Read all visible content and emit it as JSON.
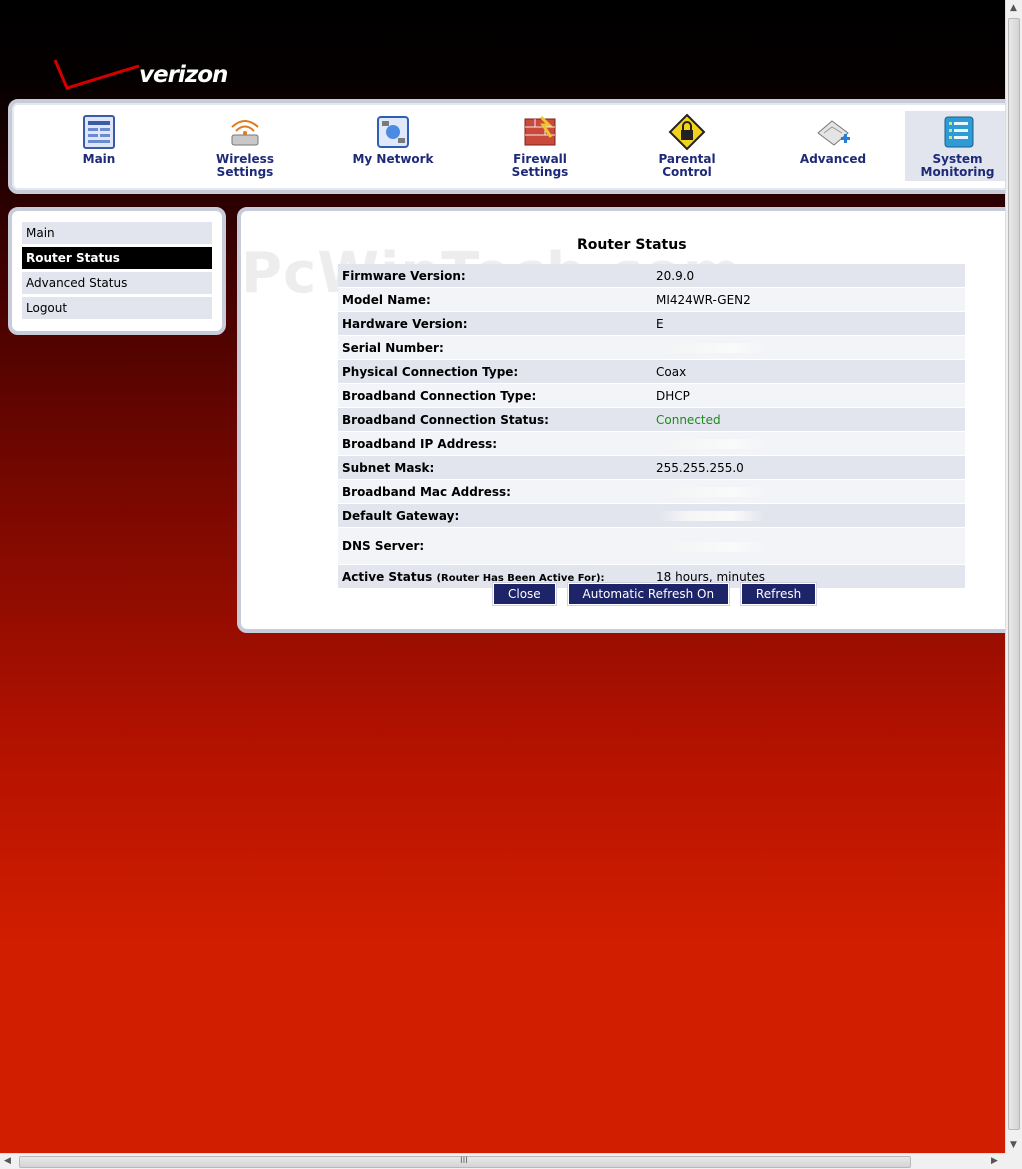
{
  "brand": {
    "logo_text": "verizon",
    "watermark": "PcWinTech.com"
  },
  "nav": [
    {
      "label": "Main",
      "icon": "main-icon",
      "active": false
    },
    {
      "label": "Wireless\nSettings",
      "icon": "wireless-icon",
      "active": false
    },
    {
      "label": "My Network",
      "icon": "network-icon",
      "active": false
    },
    {
      "label": "Firewall\nSettings",
      "icon": "firewall-icon",
      "active": false
    },
    {
      "label": "Parental\nControl",
      "icon": "lock-icon",
      "active": false
    },
    {
      "label": "Advanced",
      "icon": "advanced-icon",
      "active": false
    },
    {
      "label": "System\nMonitoring",
      "icon": "monitor-icon",
      "active": true
    }
  ],
  "sidebar": {
    "items": [
      {
        "label": "Main",
        "active": false
      },
      {
        "label": "Router Status",
        "active": true
      },
      {
        "label": "Advanced Status",
        "active": false
      },
      {
        "label": "Logout",
        "active": false
      }
    ]
  },
  "content": {
    "title": "Router Status",
    "rows": [
      {
        "label": "Firmware Version:",
        "value": "20.9.0"
      },
      {
        "label": "Model Name:",
        "value": "MI424WR-GEN2"
      },
      {
        "label": "Hardware Version:",
        "value": "E"
      },
      {
        "label": "Serial Number:",
        "value": ""
      },
      {
        "label": "Physical Connection Type:",
        "value": "Coax"
      },
      {
        "label": "Broadband Connection Type:",
        "value": "DHCP"
      },
      {
        "label": "Broadband Connection Status:",
        "value": "Connected"
      },
      {
        "label": "Broadband IP Address:",
        "value": ""
      },
      {
        "label": "Subnet Mask:",
        "value": "255.255.255.0"
      },
      {
        "label": "Broadband Mac Address:",
        "value": ""
      },
      {
        "label": "Default Gateway:",
        "value": ""
      },
      {
        "label": "DNS Server:",
        "value": ""
      },
      {
        "label": "Active Status",
        "label_note": "(Router Has Been Active For):",
        "value": "18 hours, minutes"
      }
    ],
    "buttons": {
      "close": "Close",
      "auto_refresh": "Automatic Refresh On",
      "refresh": "Refresh"
    }
  },
  "colors": {
    "nav_text": "#1e2a78",
    "button_bg": "#1e2468",
    "connected": "#1e8a1e",
    "row_odd": "#e2e4ee"
  },
  "scrollbar": {
    "h_grip": "III"
  }
}
